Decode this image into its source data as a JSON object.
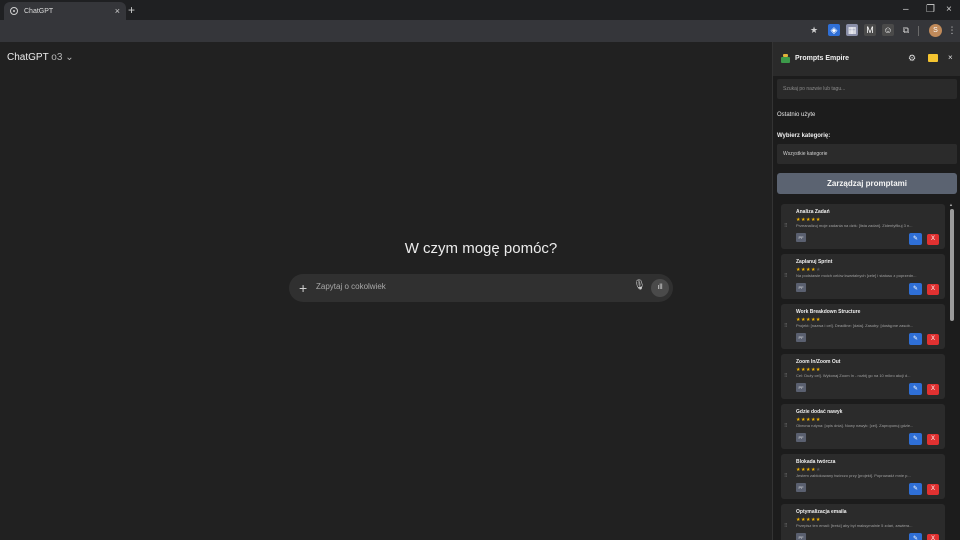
{
  "browser": {
    "tab_title": "ChatGPT",
    "tab_close": "×",
    "new_tab": "+",
    "minimize": "–",
    "restore": "❐",
    "close": "×",
    "profile_initial": "S"
  },
  "chat": {
    "model_name": "ChatGPT",
    "model_version": "o3",
    "model_chevron": "⌄",
    "headline": "W czym mogę pomóc?",
    "composer_placeholder": "Zapytaj o cokolwiek",
    "plus": "+",
    "voice_glyph": "ıll"
  },
  "panel": {
    "title": "Prompts Empire",
    "close": "×",
    "search_placeholder": "Szukaj po nazwie lub tagu...",
    "recent_label": "Ostatnio użyte",
    "category_label": "Wybierz kategorię:",
    "category_selected": "Wszystkie kategorie",
    "manage_button": "Zarządzaj promptami",
    "prompts": [
      {
        "name": "Analiza Zadań",
        "stars": "★★★★★",
        "off": "",
        "desc": "Przeanalizuj moje zadania na dziś: [lista zadań]. Zidentyfikuj 3 n...",
        "flag": "PF"
      },
      {
        "name": "Zaplanuj Sprint",
        "stars": "★★★★",
        "off": "★",
        "desc": "Na podstawie moich celów kwartalnych [cele] i statusu z poprzedn...",
        "flag": "PF"
      },
      {
        "name": "Work Breakdown Structure",
        "stars": "★★★★★",
        "off": "",
        "desc": "Projekt: [nazwa i cel]. Deadline: [data]. Zasoby: [dostępne zasob...",
        "flag": "PF"
      },
      {
        "name": "Zoom In/Zoom Out",
        "stars": "★★★★★",
        "off": "",
        "desc": "Cel: Duży cel]. Wykonaj Zoom In - rozbij go na 10 mikro akcji d...",
        "flag": "PF"
      },
      {
        "name": "Gdzie dodać nawyk",
        "stars": "★★★★★",
        "off": "",
        "desc": "Obecna rutyna: [opis dnia]. Nowy nawyk: [cel]. Zaproponuj gdzie...",
        "flag": "PF"
      },
      {
        "name": "Blokada twórcza",
        "stars": "★★★★",
        "off": "★",
        "desc": "Jestem zablokowany twórczo przy [projekt]. Poprowadź mnie p...",
        "flag": "PF"
      },
      {
        "name": "Optymalizacja emaila",
        "stars": "★★★★★",
        "off": "",
        "desc": "Przepisz ten email: [treść] aby był maksymalnie 5 zdań, zawiera...",
        "flag": "PF"
      }
    ],
    "edit_glyph": "✎",
    "delete_glyph": "X"
  },
  "colors": {
    "accent_blue": "#2f6fd6",
    "danger_red": "#e03131",
    "star_gold": "#f4b400"
  }
}
